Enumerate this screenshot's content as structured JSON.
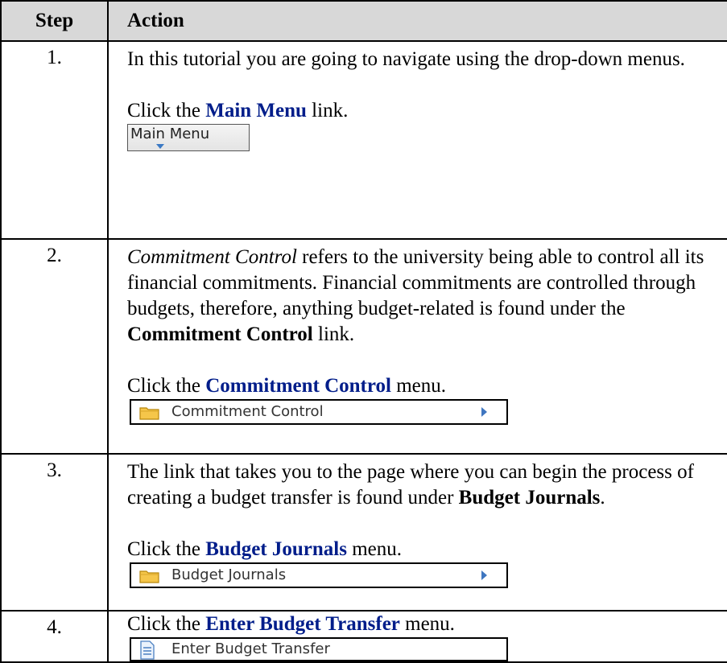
{
  "header": {
    "step": "Step",
    "action": "Action"
  },
  "rows": [
    {
      "step": "1.",
      "p1": "In this tutorial you are going to navigate using the drop-down menus.",
      "click_pre": "Click the ",
      "click_link": "Main Menu",
      "click_post": " link.",
      "capture_label": "Main Menu"
    },
    {
      "step": "2.",
      "p1_italic": "Commitment Control",
      "p1_rest": " refers to the university being able to control all its financial commitments. Financial commitments are controlled through budgets, therefore, anything budget-related is found under the ",
      "p1_bold": "Commitment Control",
      "p1_end": " link.",
      "click_pre": "Click the ",
      "click_link": "Commitment Control",
      "click_post": " menu.",
      "capture_label": "Commitment Control"
    },
    {
      "step": "3.",
      "p1_start": "The link that takes you to the page where you can begin the process of creating a budget transfer is found under ",
      "p1_bold": "Budget Journals",
      "p1_end": ".",
      "click_pre": "Click the ",
      "click_link": "Budget Journals",
      "click_post": " menu.",
      "capture_label": "Budget Journals"
    },
    {
      "step": "4.",
      "click_pre": "Click the ",
      "click_link": "Enter Budget Transfer",
      "click_post": " menu.",
      "capture_label": "Enter Budget Transfer"
    }
  ],
  "colors": {
    "link": "#001d8a",
    "header_bg": "#d8d8d8",
    "folder": "#f5c64a",
    "arrow": "#3f76c0"
  },
  "icons": {
    "main_menu": "chevron-down-icon",
    "folder": "folder-icon",
    "document": "document-icon",
    "submenu": "chevron-right-icon"
  }
}
